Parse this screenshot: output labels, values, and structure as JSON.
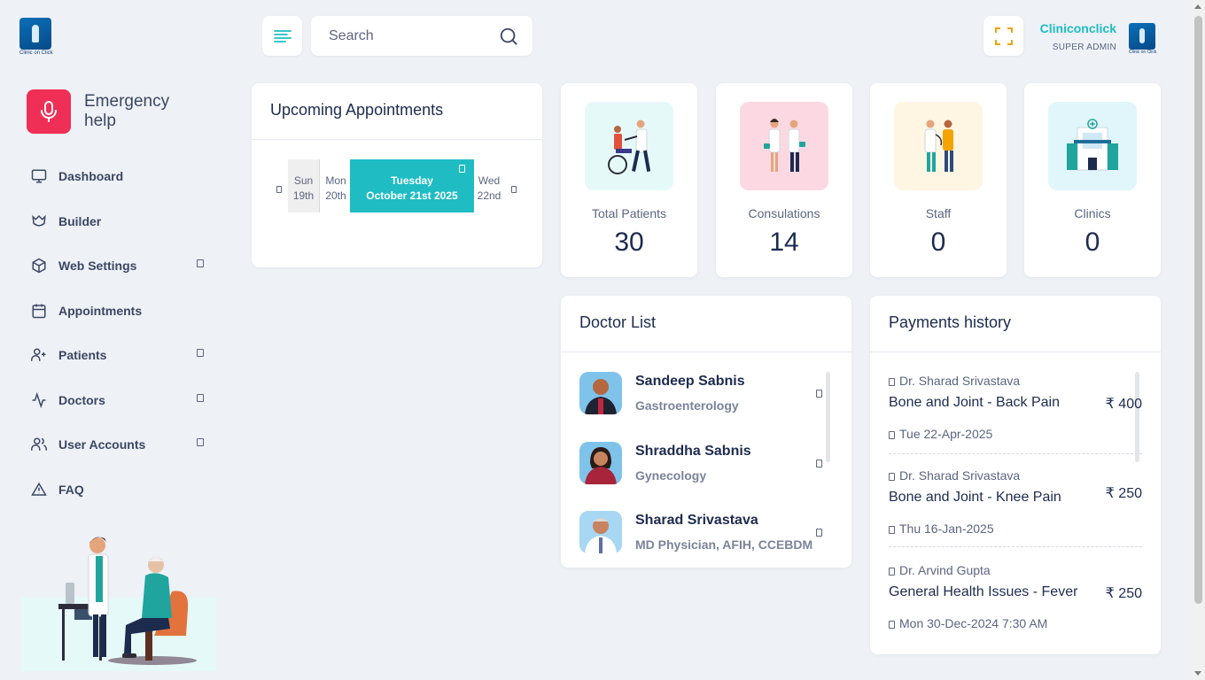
{
  "brand": {
    "logo_text": "Clinic on Click"
  },
  "sidebar": {
    "emergency": {
      "label": "Emergency help"
    },
    "items": [
      {
        "label": "Dashboard",
        "icon": "monitor-icon",
        "has_submenu": false
      },
      {
        "label": "Builder",
        "icon": "builder-icon",
        "has_submenu": false
      },
      {
        "label": "Web Settings",
        "icon": "cube-icon",
        "has_submenu": true
      },
      {
        "label": "Appointments",
        "icon": "calendar-icon",
        "has_submenu": false
      },
      {
        "label": "Patients",
        "icon": "user-plus-icon",
        "has_submenu": true
      },
      {
        "label": "Doctors",
        "icon": "activity-icon",
        "has_submenu": true
      },
      {
        "label": "User Accounts",
        "icon": "users-icon",
        "has_submenu": true
      },
      {
        "label": "FAQ",
        "icon": "warning-icon",
        "has_submenu": false
      }
    ]
  },
  "topbar": {
    "search_placeholder": "Search",
    "user_name": "Cliniconclick",
    "user_role": "SUPER ADMIN",
    "avatar_text": "Clinic on Click"
  },
  "appointments": {
    "title": "Upcoming Appointments",
    "days": [
      {
        "name": "Sun",
        "date": "19th"
      },
      {
        "name": "Mon",
        "date": "20th"
      },
      {
        "name": "Tuesday",
        "date": "October 21st 2025"
      },
      {
        "name": "Wed",
        "date": "22nd"
      }
    ]
  },
  "stats": [
    {
      "label": "Total Patients",
      "value": "30",
      "bg": "#e6f9f9"
    },
    {
      "label": "Consulations",
      "value": "14",
      "bg": "#fcd9e2"
    },
    {
      "label": "Staff",
      "value": "0",
      "bg": "#fff5e3"
    },
    {
      "label": "Clinics",
      "value": "0",
      "bg": "#e0f6fb"
    }
  ],
  "doctors": {
    "title": "Doctor List",
    "items": [
      {
        "name": "Sandeep Sabnis",
        "specialty": "Gastroenterology"
      },
      {
        "name": "Shraddha Sabnis",
        "specialty": "Gynecology"
      },
      {
        "name": "Sharad Srivastava",
        "specialty": "MD Physician, AFIH, CCEBDM"
      }
    ]
  },
  "payments": {
    "title": "Payments history",
    "items": [
      {
        "doctor": "Dr. Sharad Srivastava",
        "title": "Bone and Joint - Back Pain",
        "amount": "₹ 400",
        "when": "Tue 22-Apr-2025"
      },
      {
        "doctor": "Dr. Sharad Srivastava",
        "title": "Bone and Joint - Knee Pain",
        "amount": "₹ 250",
        "when": "Thu 16-Jan-2025"
      },
      {
        "doctor": "Dr. Arvind Gupta",
        "title": "General Health Issues - Fever",
        "amount": "₹ 250",
        "when": "Mon 30-Dec-2024 7:30 AM"
      }
    ]
  },
  "colors": {
    "accent": "#1fbcc4",
    "danger": "#ef2f55",
    "text": "#1d2b4f",
    "muted": "#5b6580"
  }
}
